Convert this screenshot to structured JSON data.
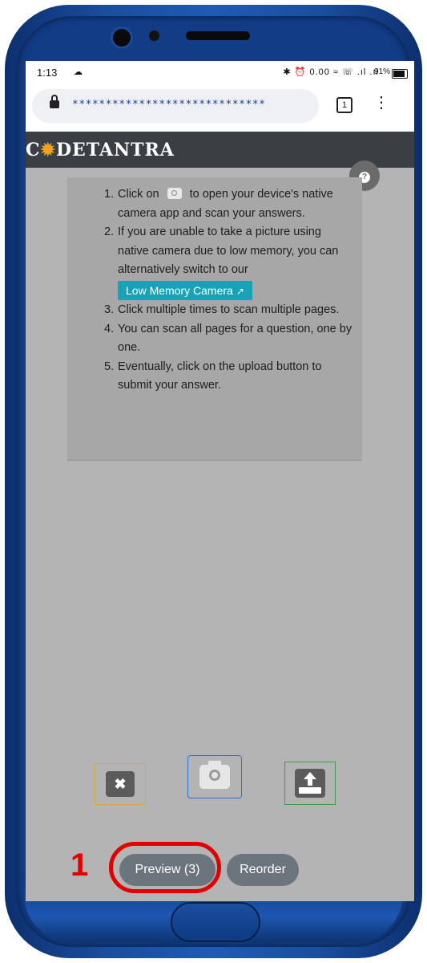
{
  "status_bar": {
    "time": "1:13",
    "system_icons_text": "✱ ⏰ 0.00 ≈ ☏ .ıl .ıl",
    "battery_percent": "91%"
  },
  "browser": {
    "url_masked": "*****************************",
    "tab_count": "1"
  },
  "app": {
    "brand_prefix": "C",
    "brand_sun": "✹",
    "brand_suffix": "DETANTRA"
  },
  "help": {
    "icon_glyph": "?"
  },
  "instructions": {
    "items": [
      {
        "num": "1.",
        "before": "Click on",
        "after": "to open your device's native camera app and scan your answers."
      },
      {
        "num": "2.",
        "text": "If you are unable to take a picture using native camera due to low memory, you can alternatively switch to our",
        "button_label": "Low Memory Camera",
        "button_icon": "↗"
      },
      {
        "num": "3.",
        "text": "Click multiple times to scan multiple pages."
      },
      {
        "num": "4.",
        "text": "You can scan all pages for a question, one by one."
      },
      {
        "num": "5.",
        "text": "Eventually, click on the upload button to submit your answer."
      }
    ]
  },
  "actions": {
    "discard_glyph": "✖"
  },
  "footer": {
    "preview_label": "Preview (3)",
    "reorder_label": "Reorder"
  },
  "annotation": {
    "step_number": "1"
  },
  "colors": {
    "accent_teal": "#17a2b8",
    "pill_gray": "#6c757d",
    "callout_red": "#e00000",
    "brand_bar": "#3a3f44"
  }
}
